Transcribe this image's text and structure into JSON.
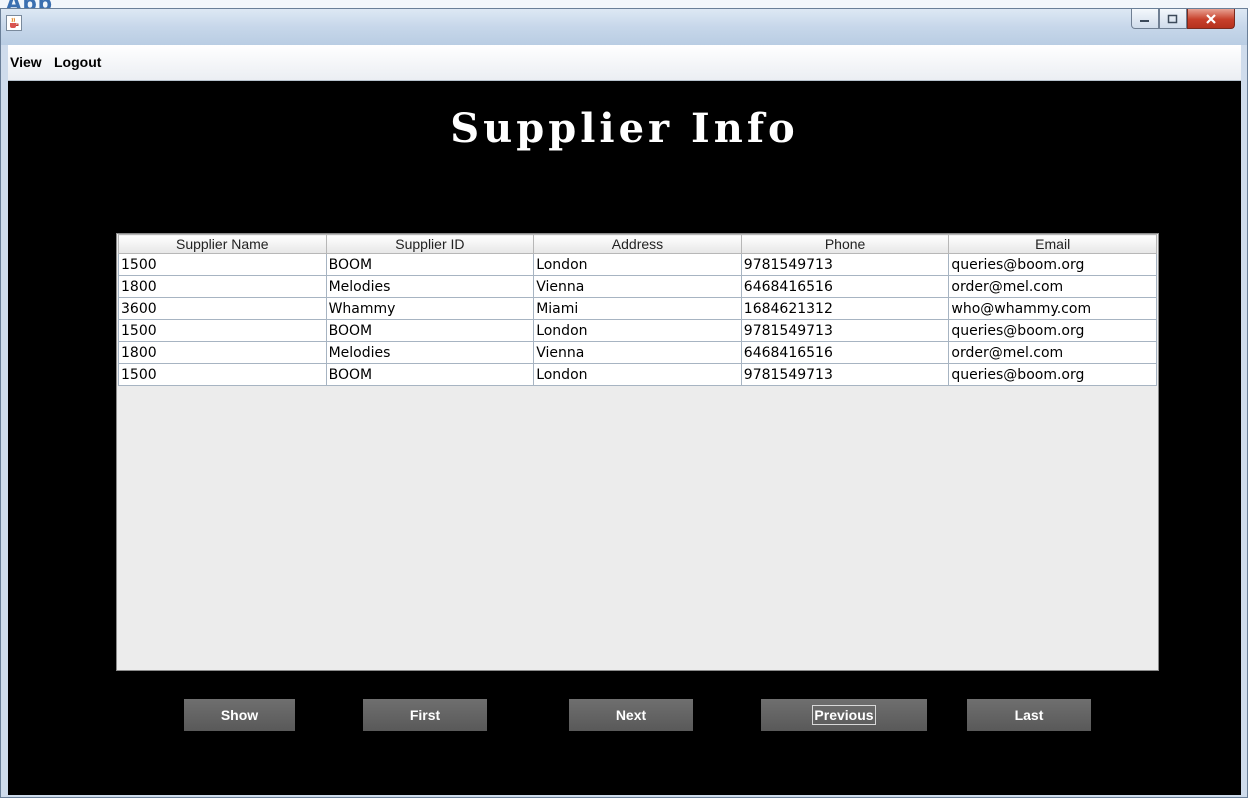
{
  "desktop": {
    "partial_text": "App"
  },
  "window": {
    "controls": {
      "minimize": "minimize-icon",
      "maximize": "maximize-icon",
      "close": "close-icon"
    },
    "app_icon": "java-cup-icon"
  },
  "menubar": {
    "items": [
      "View",
      "Logout"
    ]
  },
  "page": {
    "heading": "Supplier Info"
  },
  "table": {
    "columns": [
      "Supplier Name",
      "Supplier ID",
      "Address",
      "Phone",
      "Email"
    ],
    "rows": [
      [
        "1500",
        "BOOM",
        "London",
        "9781549713",
        "queries@boom.org"
      ],
      [
        "1800",
        "Melodies",
        "Vienna",
        "6468416516",
        "order@mel.com"
      ],
      [
        "3600",
        "Whammy",
        "Miami",
        "1684621312",
        "who@whammy.com"
      ],
      [
        "1500",
        "BOOM",
        "London",
        "9781549713",
        "queries@boom.org"
      ],
      [
        "1800",
        "Melodies",
        "Vienna",
        "6468416516",
        "order@mel.com"
      ],
      [
        "1500",
        "BOOM",
        "London",
        "9781549713",
        "queries@boom.org"
      ]
    ]
  },
  "buttons": {
    "show": "Show",
    "first": "First",
    "next": "Next",
    "previous": "Previous",
    "last": "Last"
  },
  "colors": {
    "content_bg": "#000000",
    "button_bg": "#626262",
    "close_red": "#c7402b"
  }
}
